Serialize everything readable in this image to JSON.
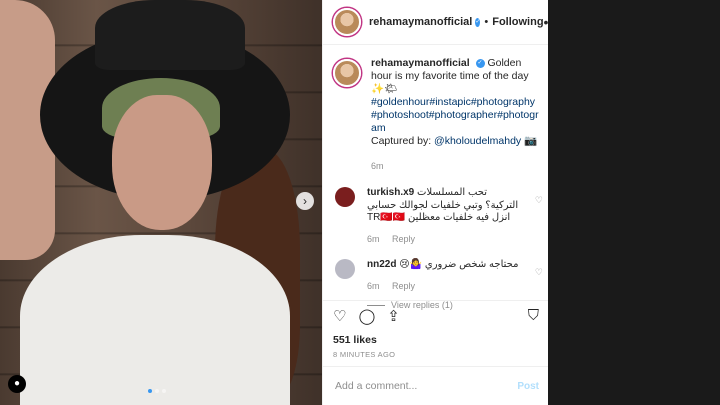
{
  "post": {
    "username": "rehamaymanofficial",
    "follow_label": "Following",
    "more_label": "•••",
    "photo_dots": 3
  },
  "caption": {
    "username": "rehamaymanofficial",
    "text": "Golden hour is my favorite time of the day ✨🌤",
    "tags": "#goldenhour#instapic#photography#photoshoot#photographer#photogram",
    "captured_prefix": "Captured by: ",
    "mention": "@kholoudelmahdy",
    "camera": "📷",
    "time": "6m"
  },
  "comments": [
    {
      "username": "turkish.x9",
      "text": "تحب المسلسلات التركية؟ وتبي خلفيات لجوالك حسابي انزل فيه خلفيات معظلين TR🇹🇷🇹🇷",
      "time": "6m",
      "reply_label": "Reply",
      "avatar_color": "#7a1e1e"
    },
    {
      "username": "nn22d",
      "text": "محتاجه شخص ضروري 🤷‍♀️😢",
      "time": "6m",
      "reply_label": "Reply",
      "view_replies": "View replies (1)",
      "avatar_color": "#b9b9c4"
    }
  ],
  "actions": {
    "likes": "551 likes",
    "time_ago": "8 MINUTES AGO"
  },
  "add_comment": {
    "placeholder": "Add a comment...",
    "post_label": "Post"
  },
  "colors": {
    "link": "#003569",
    "accent": "#3897f0",
    "muted": "#8e8e8e"
  }
}
